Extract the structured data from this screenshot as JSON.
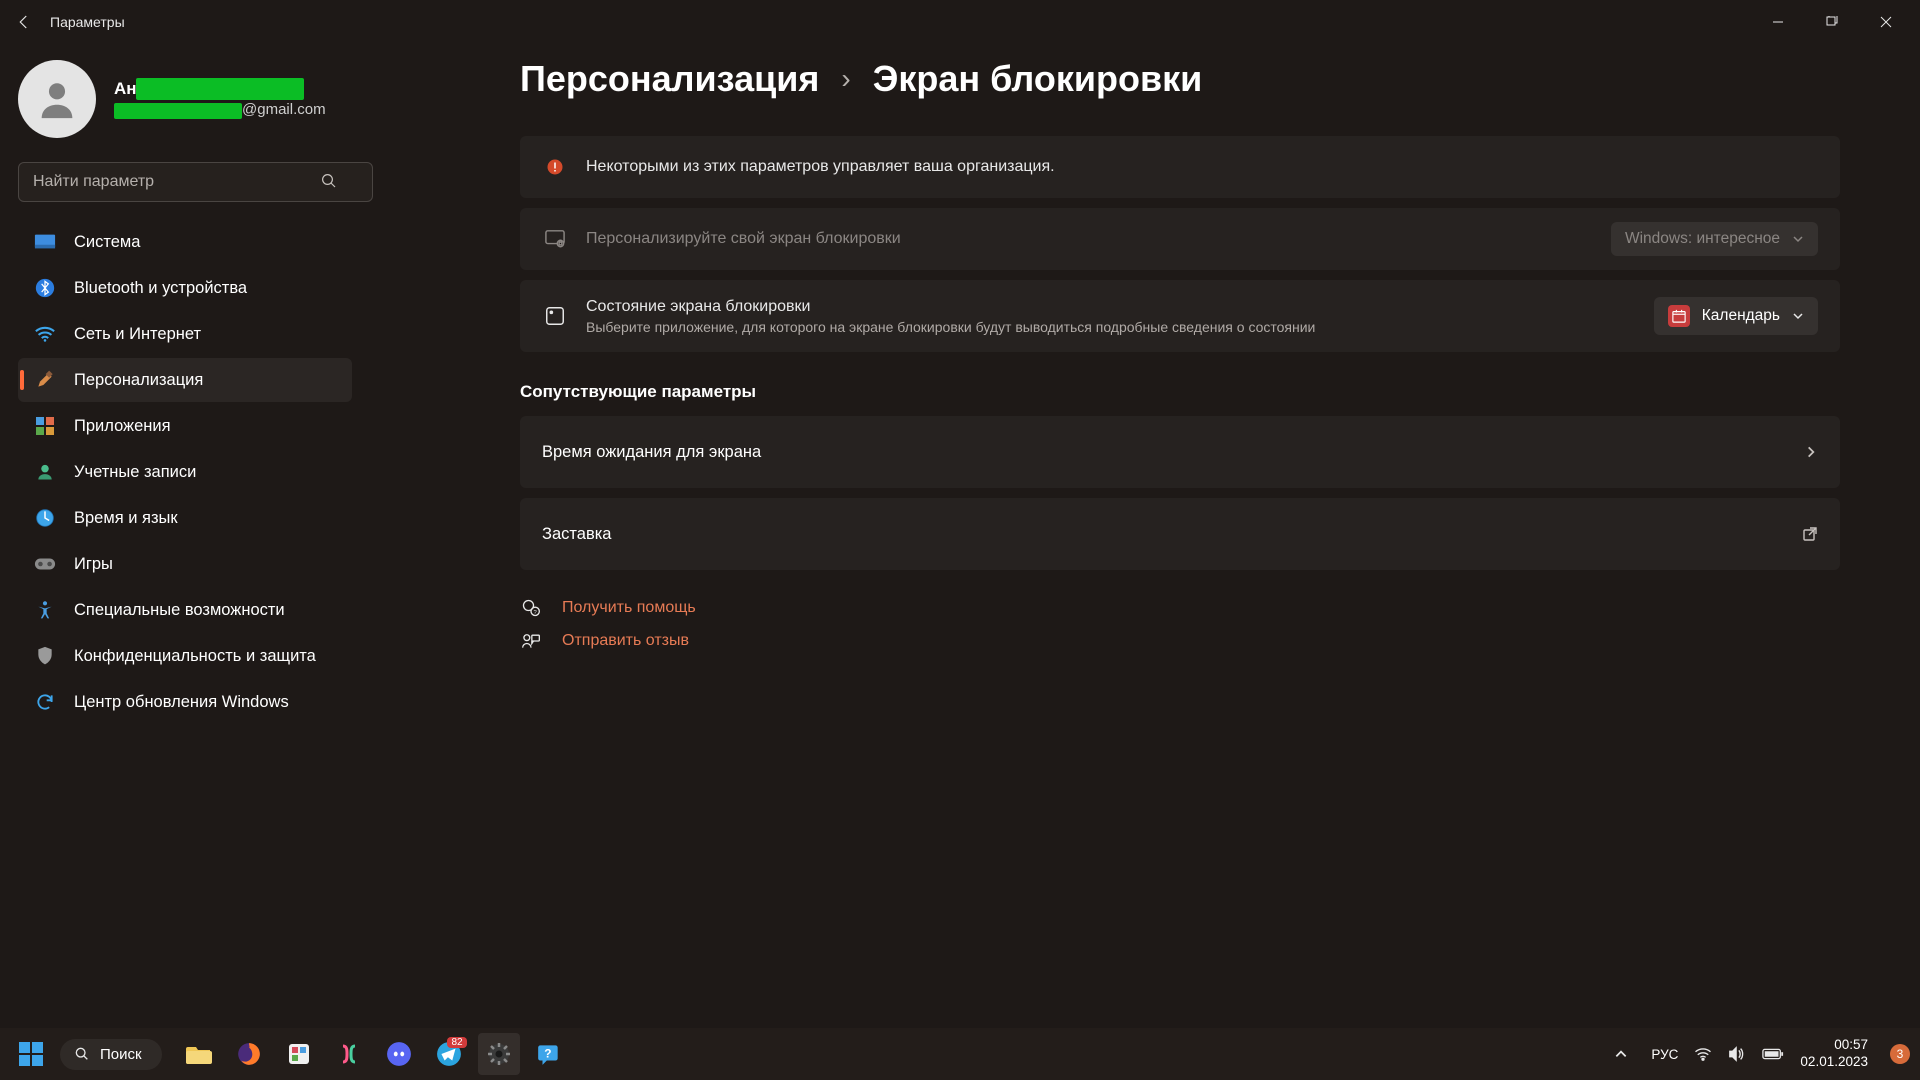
{
  "titlebar": {
    "title": "Параметры"
  },
  "profile": {
    "name_prefix": "Ан",
    "email_suffix": "@gmail.com"
  },
  "search": {
    "placeholder": "Найти параметр"
  },
  "nav": {
    "items": [
      {
        "label": "Система"
      },
      {
        "label": "Bluetooth и устройства"
      },
      {
        "label": "Сеть и Интернет"
      },
      {
        "label": "Персонализация"
      },
      {
        "label": "Приложения"
      },
      {
        "label": "Учетные записи"
      },
      {
        "label": "Время и язык"
      },
      {
        "label": "Игры"
      },
      {
        "label": "Специальные возможности"
      },
      {
        "label": "Конфиденциальность и защита"
      },
      {
        "label": "Центр обновления Windows"
      }
    ]
  },
  "breadcrumb": {
    "parent": "Персонализация",
    "current": "Экран блокировки"
  },
  "warning": {
    "text": "Некоторыми из этих параметров управляет ваша организация."
  },
  "personalize": {
    "title": "Персонализируйте свой экран блокировки",
    "dropdown": "Windows: интересное"
  },
  "status": {
    "title": "Состояние экрана блокировки",
    "sub": "Выберите приложение, для которого на экране блокировки будут выводиться подробные сведения о состоянии",
    "dropdown": "Календарь"
  },
  "related": {
    "heading": "Сопутствующие параметры",
    "timeout": "Время ожидания для экрана",
    "screensaver": "Заставка"
  },
  "help": {
    "get_help": "Получить помощь",
    "feedback": "Отправить отзыв"
  },
  "taskbar": {
    "search": "Поиск",
    "lang": "РУС",
    "time": "00:57",
    "date": "02.01.2023",
    "telegram_badge": "82",
    "notif_count": "3"
  }
}
